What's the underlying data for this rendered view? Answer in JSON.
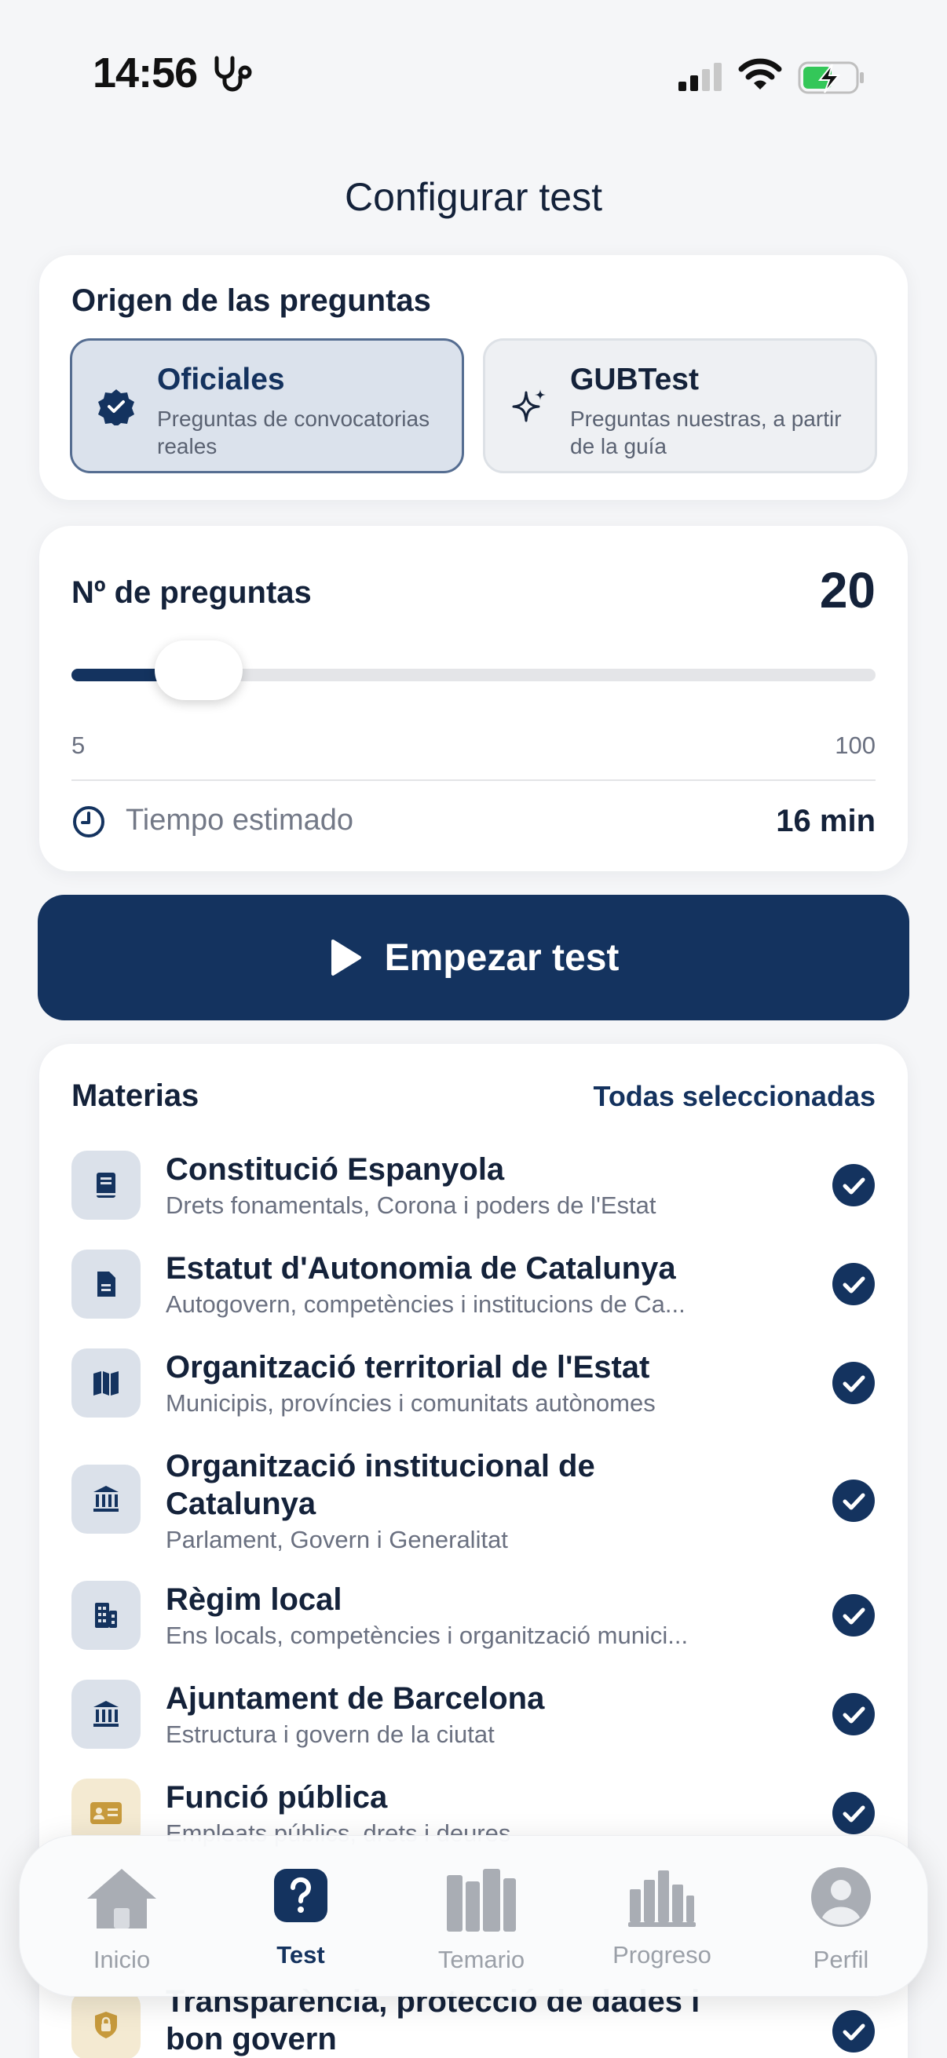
{
  "status": {
    "time": "14:56"
  },
  "title": "Configurar test",
  "origin": {
    "title": "Origen de las preguntas",
    "options": [
      {
        "label": "Oficiales",
        "sub": "Preguntas de convocatorias reales",
        "selected": true
      },
      {
        "label": "GUBTest",
        "sub": "Preguntas nuestras, a partir de la guía",
        "selected": false
      }
    ]
  },
  "count": {
    "title": "Nº de preguntas",
    "value": "20",
    "min": "5",
    "max": "100",
    "slider_fraction": 0.158,
    "time_label": "Tiempo estimado",
    "time_value": "16 min"
  },
  "start_button": "Empezar test",
  "subjects": {
    "title": "Materias",
    "all_label": "Todas seleccionadas",
    "items": [
      {
        "name": "Constitució Espanyola",
        "desc": "Drets fonamentals, Corona i poders de l'Estat",
        "icon": "book-icon",
        "checked": true
      },
      {
        "name": "Estatut d'Autonomia de Catalunya",
        "desc": "Autogovern, competències i institucions de Ca...",
        "icon": "document-icon",
        "checked": true
      },
      {
        "name": "Organització territorial de l'Estat",
        "desc": "Municipis, províncies i comunitats autònomes",
        "icon": "map-icon",
        "checked": true
      },
      {
        "name": "Organització institucional de Catalunya",
        "desc": "Parlament, Govern i Generalitat",
        "icon": "institution-icon",
        "checked": true
      },
      {
        "name": "Règim local",
        "desc": "Ens locals, competències i organització munici...",
        "icon": "building-icon",
        "checked": true
      },
      {
        "name": "Ajuntament de Barcelona",
        "desc": "Estructura i govern de la ciutat",
        "icon": "institution-icon",
        "checked": true
      },
      {
        "name": "Funció pública",
        "desc": "Empleats públics, drets i deures",
        "icon": "id-card-icon",
        "checked": true
      },
      {
        "name": "Transparència, protecció de dades i bon govern",
        "desc": "",
        "icon": "shield-lock-icon",
        "checked": true
      }
    ]
  },
  "tabs": [
    {
      "label": "Inicio",
      "icon": "home-icon",
      "active": false
    },
    {
      "label": "Test",
      "icon": "question-icon",
      "active": true
    },
    {
      "label": "Temario",
      "icon": "books-icon",
      "active": false
    },
    {
      "label": "Progreso",
      "icon": "bar-chart-icon",
      "active": false
    },
    {
      "label": "Perfil",
      "icon": "person-icon",
      "active": false
    }
  ],
  "colors": {
    "primary": "#14335f",
    "background": "#f5f6f8",
    "card": "#ffffff",
    "muted": "#6a7080"
  }
}
